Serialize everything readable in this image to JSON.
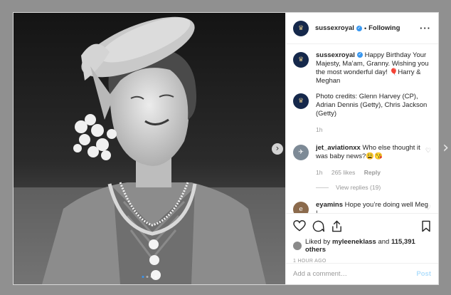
{
  "modal": {
    "outer_next_icon": "chevron-right",
    "photo": {
      "next_icon": "chevron-right",
      "carousel": {
        "count": 4,
        "active_index": 0
      }
    },
    "header": {
      "avatar_icon": "royal-monogram",
      "username": "sussexroyal",
      "separator": "•",
      "follow_status": "Following",
      "more_icon": "more-horizontal"
    },
    "comments": [
      {
        "avatar_icon": "royal-monogram",
        "username": "sussexroyal",
        "text": "Happy Birthday Your Majesty, Ma’am, Granny. Wishing you the most wonderful day! 🎈Harry & Meghan",
        "text2": "Photo credits: Glenn Harvey (CP), Adrian Dennis (Getty), Chris Jackson (Getty)",
        "time": "1h"
      },
      {
        "avatar_icon": "user-photo",
        "username": "jet_aviationxx",
        "text": "Who else thought it was baby news?😩😘",
        "time": "1h",
        "likes": "265 likes",
        "reply": "Reply",
        "view_replies": "View replies (19)"
      },
      {
        "avatar_icon": "user-photo",
        "username": "eyamins",
        "text": "Hope you’re doing well Meg !"
      }
    ],
    "actions": {
      "like_icon": "heart",
      "comment_icon": "comment",
      "share_icon": "share",
      "save_icon": "bookmark",
      "liked_prefix": "Liked by",
      "liked_user": "myleeneklass",
      "liked_and": "and",
      "liked_count": "115,391 others",
      "timestamp": "1 HOUR AGO"
    },
    "add_comment": {
      "placeholder": "Add a comment…",
      "post_label": "Post"
    }
  }
}
